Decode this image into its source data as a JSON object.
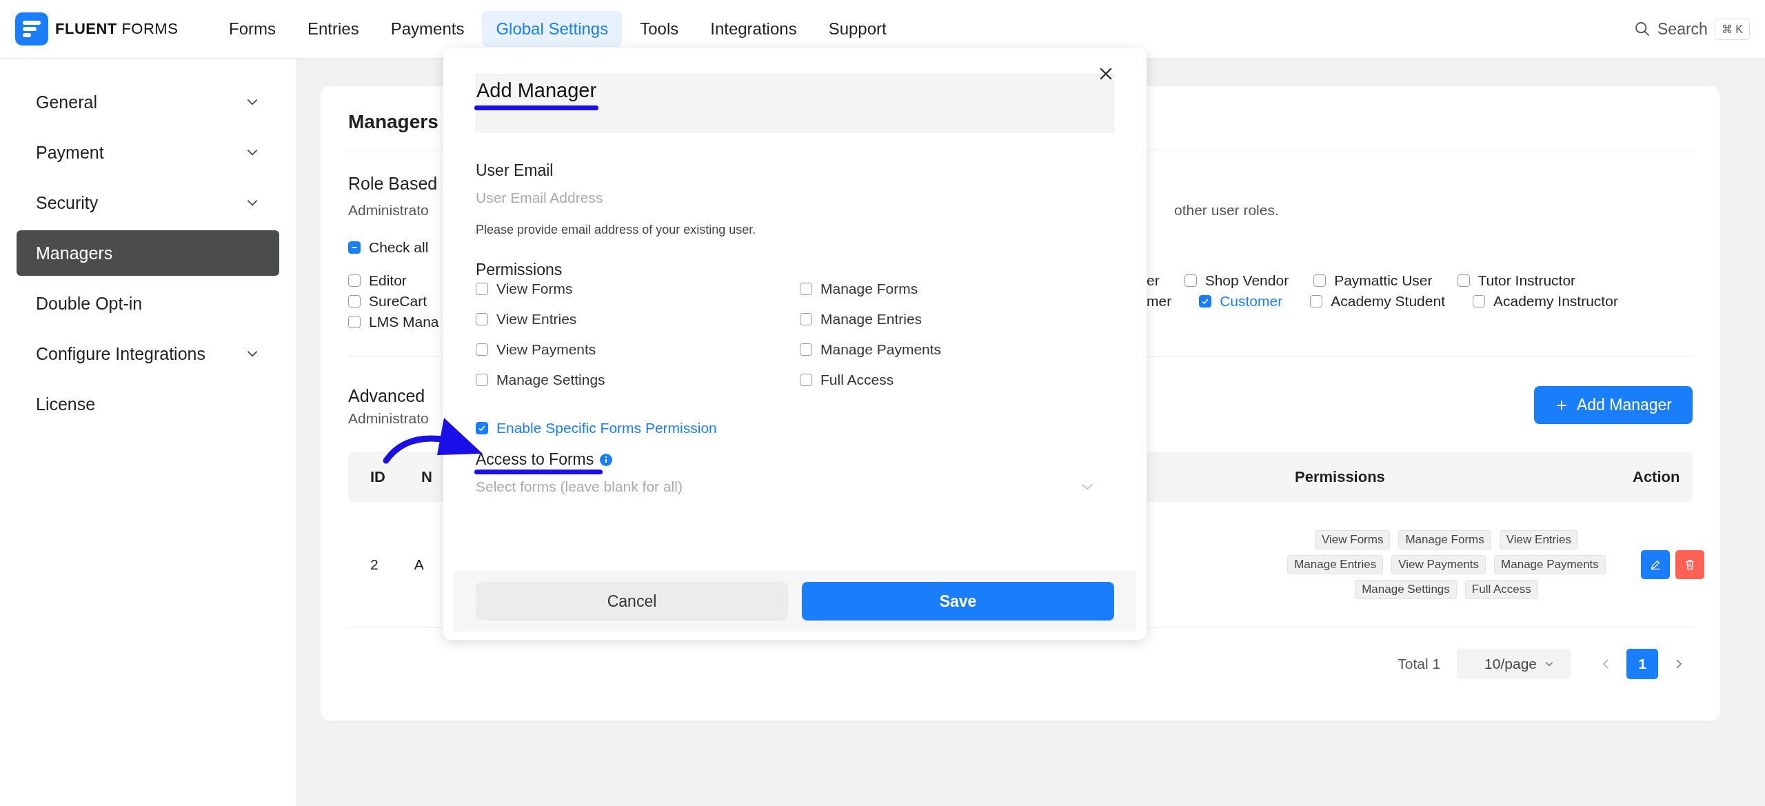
{
  "brand": "**FLUENT** FORMS",
  "nav": [
    {
      "label": "Forms",
      "selected": false
    },
    {
      "label": "Entries",
      "selected": false
    },
    {
      "label": "Payments",
      "selected": false
    },
    {
      "label": "Global Settings",
      "selected": true
    },
    {
      "label": "Tools",
      "selected": false
    },
    {
      "label": "Integrations",
      "selected": false
    },
    {
      "label": "Support",
      "selected": false
    }
  ],
  "search": {
    "label": "Search",
    "shortcut": "⌘ K"
  },
  "sidebar": [
    {
      "label": "General",
      "expandable": true,
      "selected": false
    },
    {
      "label": "Payment",
      "expandable": true,
      "selected": false
    },
    {
      "label": "Security",
      "expandable": true,
      "selected": false
    },
    {
      "label": "Managers",
      "expandable": false,
      "selected": true
    },
    {
      "label": "Double Opt-in",
      "expandable": false,
      "selected": false
    },
    {
      "label": "Configure Integrations",
      "expandable": true,
      "selected": false
    },
    {
      "label": "License",
      "expandable": false,
      "selected": false
    }
  ],
  "page": {
    "title": "Managers",
    "role_section": {
      "title": "Role Based",
      "description_start": "Administrato",
      "description_end": "other user roles.",
      "check_all": {
        "label": "Check all",
        "indeterminate": true
      },
      "left_roles": [
        {
          "label": "Editor",
          "checked": false
        },
        {
          "label": "SureCart",
          "checked": false
        },
        {
          "label": "LMS Mana",
          "checked": false
        }
      ],
      "right_rows": [
        [
          {
            "kind": "fragment",
            "label": "er"
          },
          {
            "kind": "checkbox",
            "label": "Shop Vendor",
            "checked": false
          },
          {
            "kind": "checkbox",
            "label": "Paymattic User",
            "checked": false
          },
          {
            "kind": "checkbox",
            "label": "Tutor Instructor",
            "checked": false
          }
        ],
        [
          {
            "kind": "fragment",
            "label": "mer"
          },
          {
            "kind": "checkbox",
            "label": "Customer",
            "checked": true
          },
          {
            "kind": "checkbox",
            "label": "Academy Student",
            "checked": false
          },
          {
            "kind": "checkbox",
            "label": "Academy Instructor",
            "checked": false
          }
        ]
      ]
    },
    "advanced": {
      "title": "Advanced",
      "description_start": "Administrato",
      "add_button": "Add Manager"
    },
    "table": {
      "columns": [
        "ID",
        "N",
        "Permissions",
        "Action"
      ],
      "rows": [
        {
          "id": "2",
          "column_2": "A",
          "permissions": [
            "View Forms",
            "Manage Forms",
            "View Entries",
            "Manage Entries",
            "View Payments",
            "Manage Payments",
            "Manage Settings",
            "Full Access"
          ]
        }
      ]
    },
    "pagination": {
      "total": "Total 1",
      "page_size": "10/page",
      "pages": [
        {
          "label": "1",
          "selected": true
        }
      ]
    }
  },
  "modal": {
    "title": "Add Manager",
    "email_label": "User Email",
    "email_placeholder": "User Email Address",
    "email_help": "Please provide email address of your existing user.",
    "permissions_label": "Permissions",
    "permissions": [
      {
        "label": "View Forms",
        "checked": false
      },
      {
        "label": "Manage Forms",
        "checked": false
      },
      {
        "label": "View Entries",
        "checked": false
      },
      {
        "label": "Manage Entries",
        "checked": false
      },
      {
        "label": "View Payments",
        "checked": false
      },
      {
        "label": "Manage Payments",
        "checked": false
      },
      {
        "label": "Manage Settings",
        "checked": false
      },
      {
        "label": "Full Access",
        "checked": false
      }
    ],
    "specific_forms": {
      "label": "Enable Specific Forms Permission",
      "checked": true
    },
    "access_label": "Access to Forms",
    "access_placeholder": "Select forms (leave blank for all)",
    "cancel": "Cancel",
    "save": "Save"
  }
}
